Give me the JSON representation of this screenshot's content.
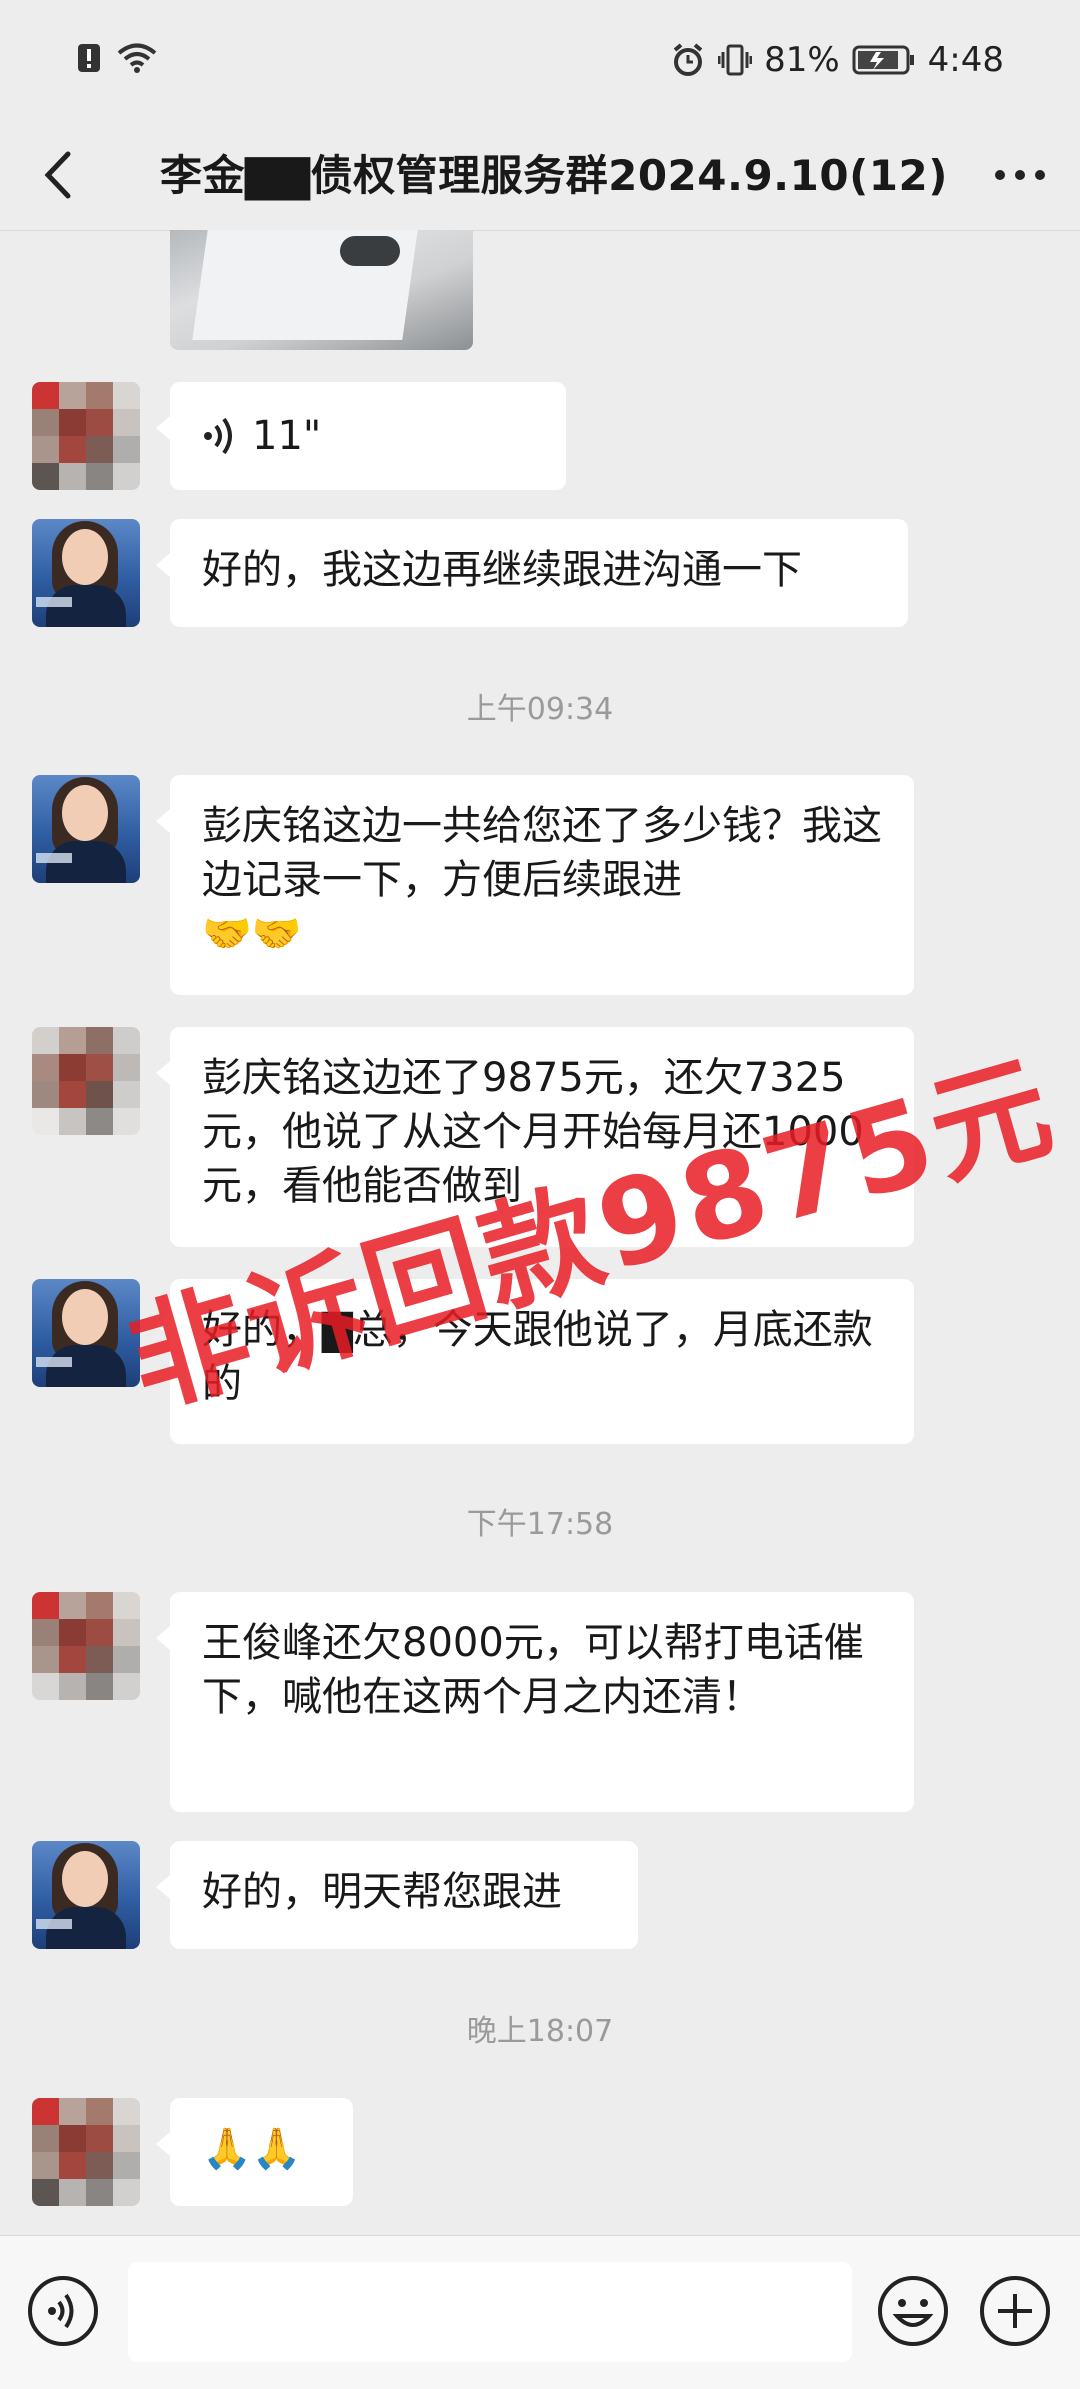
{
  "status_bar": {
    "battery": "81%",
    "time": "4:48"
  },
  "header": {
    "title": "李金▇▇债权管理服务群2024.9.10(12)"
  },
  "messages": {
    "voice_duration": "11\"",
    "m1": "好的，我这边再继续跟进沟通一下",
    "t1": "上午09:34",
    "m2": "彭庆铭这边一共给您还了多少钱？我这边记录一下，方便后续跟进",
    "m2_emoji": "🤝🤝",
    "m3": "彭庆铭这边还了9875元，还欠7325元，他说了从这个月开始每月还1000元，看他能否做到",
    "m4": "好的，▇总，今天跟他说了，月底还款的",
    "t2": "下午17:58",
    "m5": "王俊峰还欠8000元，可以帮打电话催下，喊他在这两个月之内还清！",
    "m6": "好的，明天帮您跟进",
    "t3": "晚上18:07",
    "m7": "🙏🙏"
  },
  "watermark": "非诉回款9875元",
  "colors": {
    "background": "#ededed",
    "bubble": "#ffffff",
    "watermark": "#e71c24"
  }
}
